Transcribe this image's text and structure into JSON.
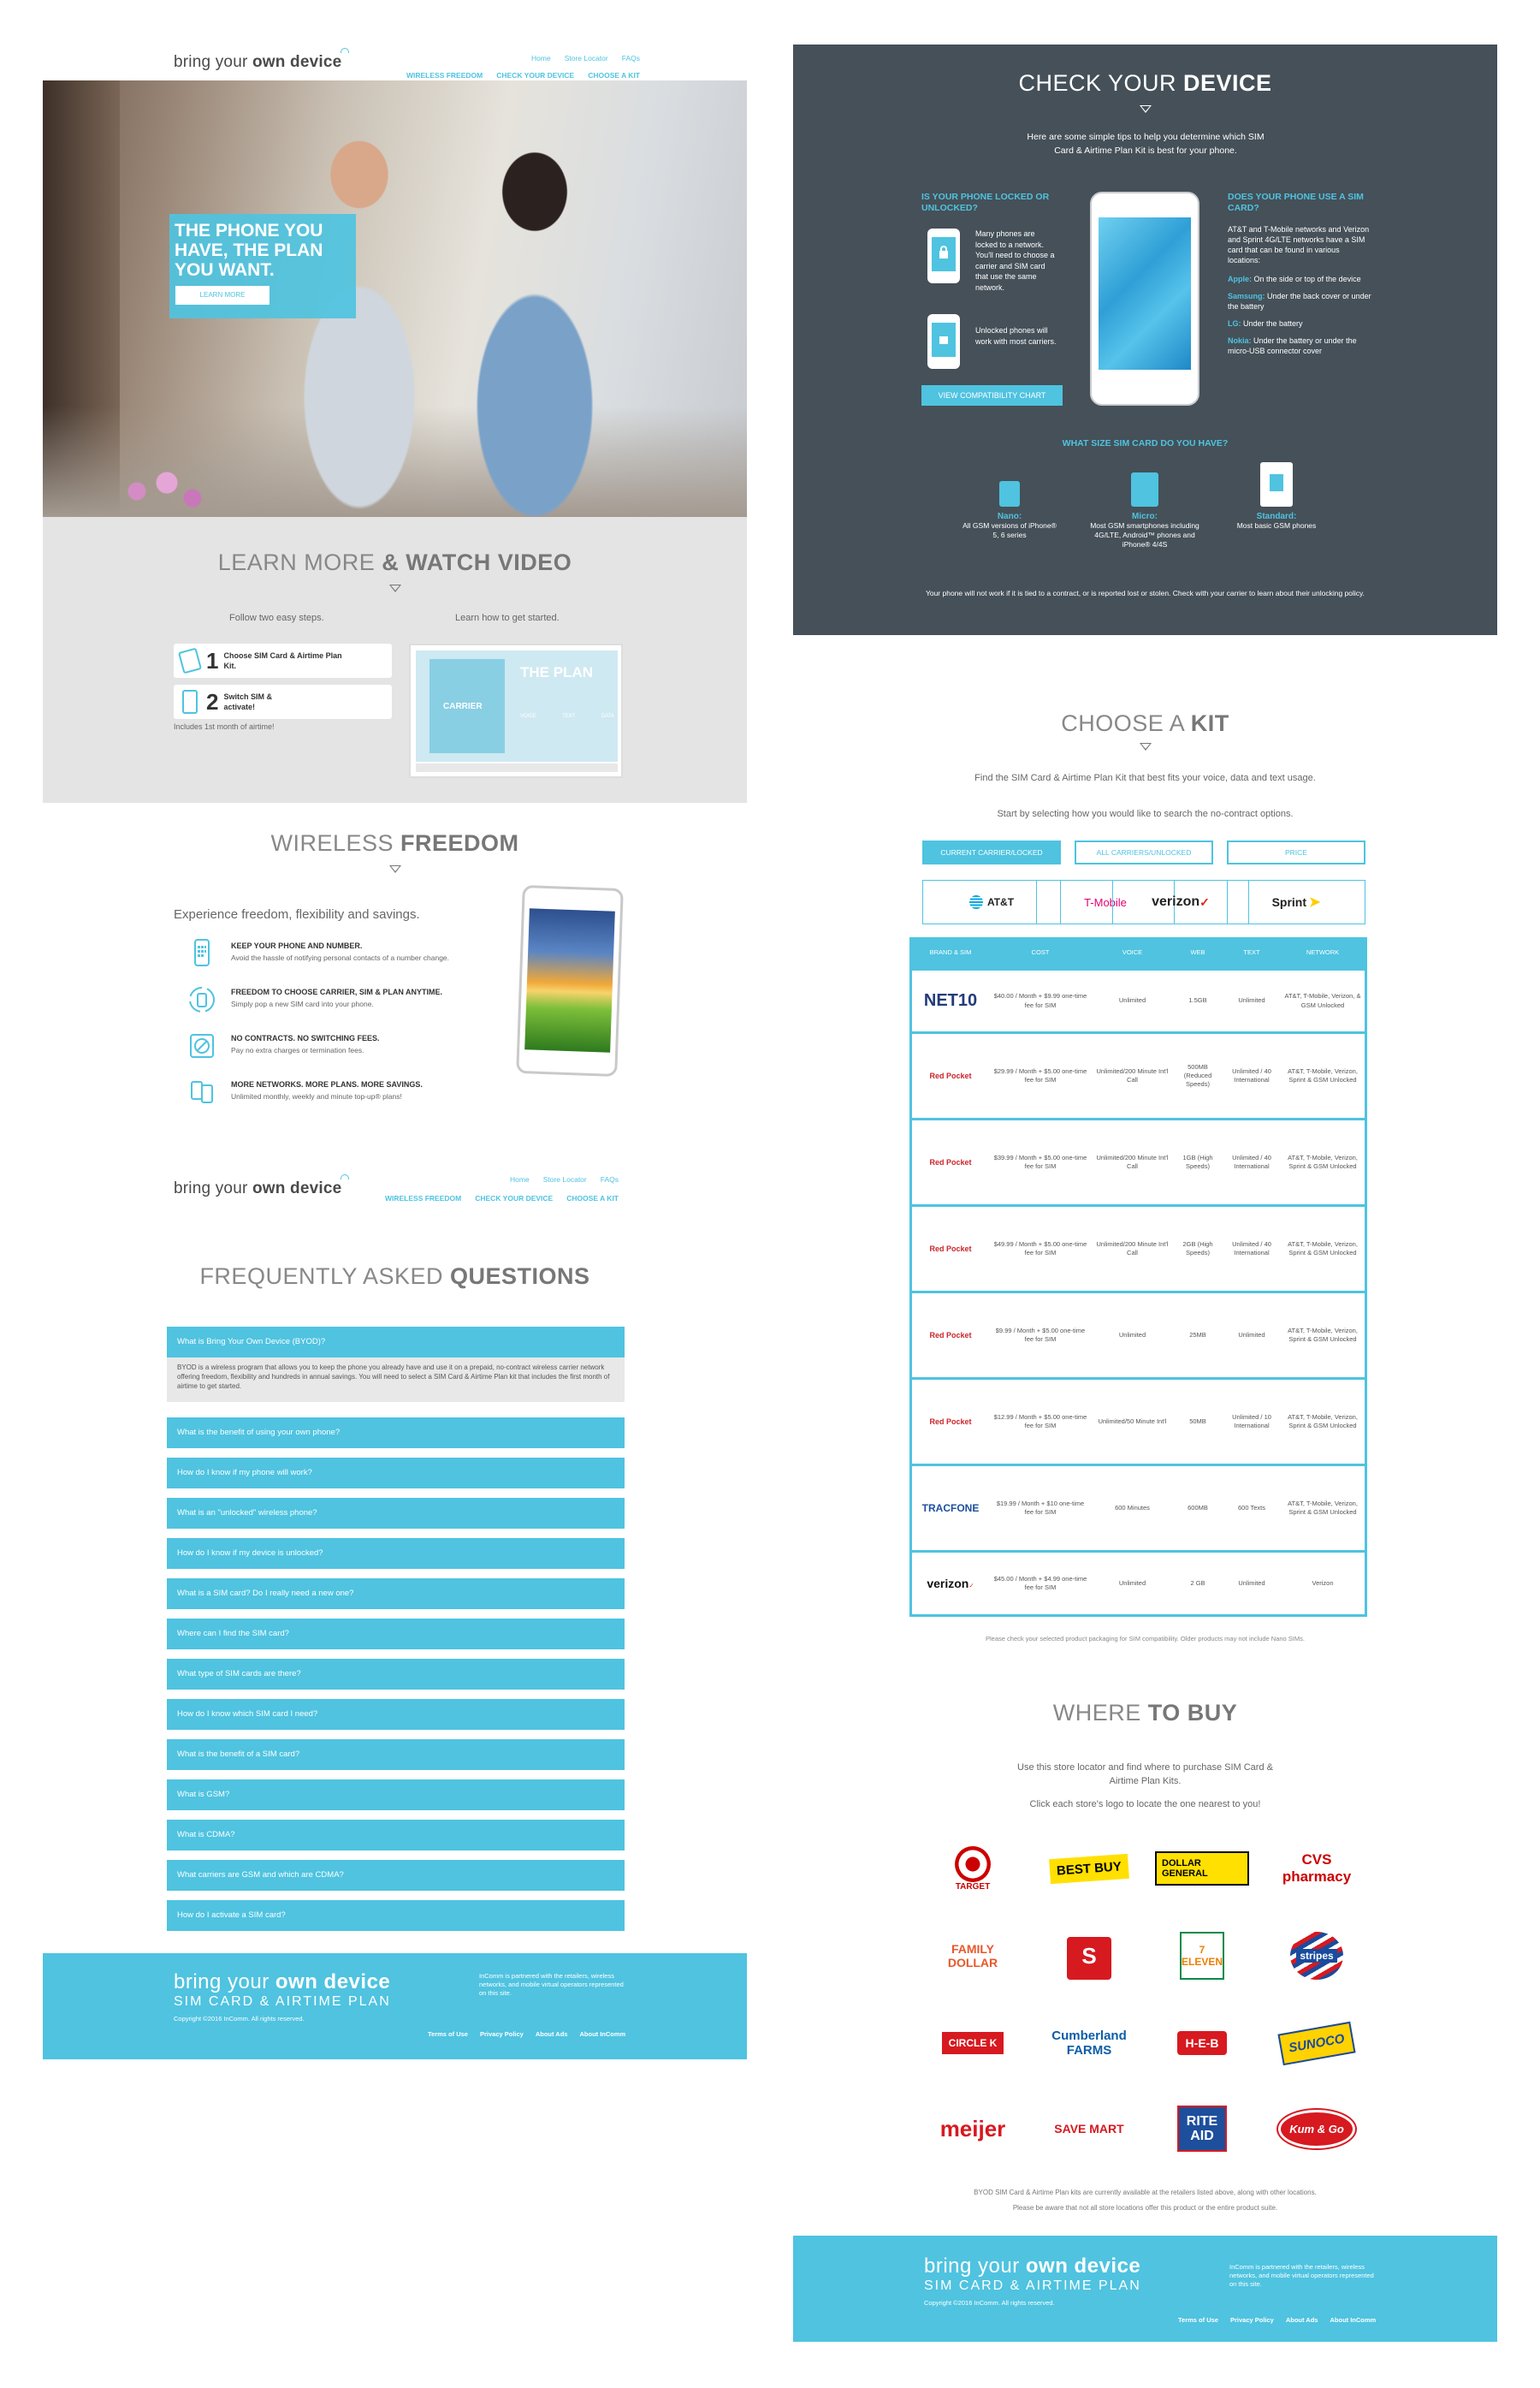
{
  "logo": {
    "prefix": "bring your ",
    "bold": "own device"
  },
  "top_nav": [
    "Home",
    "Store Locator",
    "FAQs"
  ],
  "main_nav": [
    "WIRELESS FREEDOM",
    "CHECK YOUR DEVICE",
    "CHOOSE A KIT"
  ],
  "hero": {
    "headline": "THE PHONE YOU HAVE, THE PLAN YOU WANT.",
    "button": "LEARN MORE"
  },
  "learn": {
    "title_light": "LEARN MORE ",
    "title_bold": "& WATCH VIDEO",
    "left_caption": "Follow two easy steps.",
    "right_caption": "Learn how to get started.",
    "steps": [
      {
        "num": "1",
        "text": "Choose SIM Card & Airtime Plan Kit."
      },
      {
        "num": "2",
        "text": "Switch SIM & activate!"
      }
    ],
    "footnote": "Includes 1st month of airtime!",
    "video": {
      "title": "THE PLAN",
      "subtitle": "CARRIER",
      "labels": [
        "VOICE",
        "TEXT",
        "DATA"
      ]
    }
  },
  "wireless": {
    "title_light": "WIRELESS ",
    "title_bold": "FREEDOM",
    "intro": "Experience freedom, flexibility and savings.",
    "features": [
      {
        "icon": "phone-number-icon",
        "title": "KEEP YOUR PHONE AND NUMBER.",
        "text": "Avoid the hassle of notifying personal contacts of a number change."
      },
      {
        "icon": "switch-carrier-icon",
        "title": "FREEDOM TO CHOOSE CARRIER, SIM & PLAN ANYTIME.",
        "text": "Simply pop a new SIM card into your phone."
      },
      {
        "icon": "no-contract-icon",
        "title": "NO CONTRACTS. NO SWITCHING FEES.",
        "text": "Pay no extra charges or termination fees."
      },
      {
        "icon": "networks-icon",
        "title": "MORE NETWORKS. MORE PLANS. MORE SAVINGS.",
        "text": "Unlimited monthly, weekly and minute top-up® plans!"
      }
    ]
  },
  "faq": {
    "title_light": "FREQUENTLY ASKED ",
    "title_bold": "QUESTIONS",
    "open_question": "What is Bring Your Own Device (BYOD)?",
    "open_answer": "BYOD is a wireless program that allows you to keep the phone you already have and use it on a prepaid, no-contract wireless carrier network offering freedom, flexibility and hundreds in annual savings. You will need to select a SIM Card & Airtime Plan kit that includes the first month of airtime to get started.",
    "questions": [
      "What is the benefit of using your own phone?",
      "How do I know if my phone will work?",
      "What is an \"unlocked\" wireless phone?",
      "How do I know if my device is unlocked?",
      "What is a SIM card? Do I really need a new one?",
      "Where can I find the SIM card?",
      "What type of SIM cards are there?",
      "How do I know which SIM card I need?",
      "What is the benefit of a SIM card?",
      "What is GSM?",
      "What is CDMA?",
      "What carriers are GSM and which are CDMA?",
      "How do I activate a SIM card?"
    ]
  },
  "footer": {
    "logo_prefix": "bring your ",
    "logo_bold": "own device",
    "sub": "SIM CARD & AIRTIME PLAN",
    "copyright": "Copyright ©2016 InComm. All rights reserved.",
    "partner": "InComm is partnered with the retailers, wireless networks, and mobile virtual operators represented on this site.",
    "links": [
      "Terms of Use",
      "Privacy Policy",
      "About Ads",
      "About InComm"
    ]
  },
  "check": {
    "title_light": "CHECK YOUR ",
    "title_bold": "DEVICE",
    "intro": "Here are some simple tips to help you determine which SIM Card & Airtime Plan Kit is best for your phone.",
    "locked_heading": "IS YOUR PHONE LOCKED OR UNLOCKED?",
    "locked_text": "Many phones are locked to a network. You'll need to choose a carrier and SIM card that use the same network.",
    "unlocked_text": "Unlocked phones will work with most carriers.",
    "compat_button": "VIEW COMPATIBILITY CHART",
    "sim_heading": "DOES YOUR PHONE USE A SIM CARD?",
    "sim_text": "AT&T and T-Mobile networks and Verizon and Sprint 4G/LTE networks have a SIM card that can be found in various locations:",
    "locations": [
      {
        "brand": "Apple:",
        "text": "On the side or top of the device"
      },
      {
        "brand": "Samsung:",
        "text": "Under the back cover or under the battery"
      },
      {
        "brand": "LG:",
        "text": "Under the battery"
      },
      {
        "brand": "Nokia:",
        "text": "Under the battery or under the micro-USB connector cover"
      }
    ],
    "size_heading": "WHAT SIZE SIM CARD DO YOU HAVE?",
    "sizes": [
      {
        "name": "Nano:",
        "text": "All GSM versions of iPhone® 5, 6 series"
      },
      {
        "name": "Micro:",
        "text": "Most GSM smartphones including 4G/LTE, Android™ phones and iPhone® 4/4S"
      },
      {
        "name": "Standard:",
        "text": "Most basic GSM phones"
      }
    ],
    "note": "Your phone will not work if it is tied to a contract, or is reported lost or stolen. Check with your carrier to learn about their unlocking policy."
  },
  "kit": {
    "title_light": "CHOOSE A ",
    "title_bold": "KIT",
    "intro": "Find the SIM Card & Airtime Plan Kit that best fits your voice, data and text usage.",
    "instruction": "Start by selecting how you would like to search the no-contract options.",
    "tabs": [
      "CURRENT CARRIER/LOCKED",
      "ALL CARRIERS/UNLOCKED",
      "PRICE"
    ],
    "carriers": [
      "AT&T",
      "T-Mobile",
      "verizon",
      "Sprint"
    ],
    "columns": [
      "BRAND & SIM",
      "COST",
      "VOICE",
      "WEB",
      "TEXT",
      "NETWORK"
    ],
    "rows": [
      {
        "brand": "NET10",
        "cost": "$40.00 / Month + $9.99 one-time fee for SIM",
        "voice": "Unlimited",
        "web": "1.5GB",
        "text": "Unlimited",
        "network": "AT&T, T-Mobile, Verizon, & GSM Unlocked"
      },
      {
        "brand": "Red Pocket",
        "cost": "$29.99 / Month + $5.00 one-time fee for SIM",
        "voice": "Unlimited/200 Minute Int'l Call",
        "web": "500MB (Reduced Speeds)",
        "text": "Unlimited / 40 International",
        "network": "AT&T, T-Mobile, Verizon, Sprint & GSM Unlocked"
      },
      {
        "brand": "Red Pocket",
        "cost": "$39.99 / Month + $5.00 one-time fee for SIM",
        "voice": "Unlimited/200 Minute Int'l Call",
        "web": "1GB (High Speeds)",
        "text": "Unlimited / 40 International",
        "network": "AT&T, T-Mobile, Verizon, Sprint & GSM Unlocked"
      },
      {
        "brand": "Red Pocket",
        "cost": "$49.99 / Month + $5.00 one-time fee for SIM",
        "voice": "Unlimited/200 Minute Int'l Call",
        "web": "2GB (High Speeds)",
        "text": "Unlimited / 40 International",
        "network": "AT&T, T-Mobile, Verizon, Sprint & GSM Unlocked"
      },
      {
        "brand": "Red Pocket",
        "cost": "$9.99 / Month + $5.00 one-time fee for SIM",
        "voice": "Unlimited",
        "web": "25MB",
        "text": "Unlimited",
        "network": "AT&T, T-Mobile, Verizon, Sprint & GSM Unlocked"
      },
      {
        "brand": "Red Pocket",
        "cost": "$12.99 / Month + $5.00 one-time fee for SIM",
        "voice": "Unlimited/50 Minute Int'l",
        "web": "50MB",
        "text": "Unlimited / 10 International",
        "network": "AT&T, T-Mobile, Verizon, Sprint & GSM Unlocked"
      },
      {
        "brand": "TRACFONE",
        "cost": "$19.99 / Month + $10 one-time fee for SIM",
        "voice": "600 Minutes",
        "web": "600MB",
        "text": "600 Texts",
        "network": "AT&T, T-Mobile, Verizon, Sprint & GSM Unlocked"
      },
      {
        "brand": "verizon",
        "cost": "$45.00 / Month + $4.99 one-time fee for SIM",
        "voice": "Unlimited",
        "web": "2 GB",
        "text": "Unlimited",
        "network": "Verizon"
      }
    ],
    "table_note": "Please check your selected product packaging for SIM compatibility. Older products may not include Nano SIMs."
  },
  "buy": {
    "title_light": "WHERE ",
    "title_bold": "TO BUY",
    "intro": "Use this store locator and find where to purchase SIM Card & Airtime Plan Kits.",
    "instruction": "Click each store's logo to locate the one nearest to you!",
    "stores": [
      "TARGET",
      "BEST BUY",
      "DOLLAR GENERAL",
      "CVS pharmacy",
      "FAMILY DOLLAR",
      "Speedway",
      "7 ELEVEN",
      "stripes",
      "CIRCLE K",
      "Cumberland FARMS",
      "H-E-B",
      "SUNOCO",
      "meijer",
      "SAVE MART",
      "RITE AID",
      "Kum & Go"
    ],
    "note1": "BYOD SIM Card & Airtime Plan kits are currently available at the retailers listed above, along with other locations.",
    "note2": "Please be aware that not all store locations offer this product or the entire product suite."
  },
  "colors": {
    "accent": "#4fc3e0",
    "dark_panel": "#455058",
    "grey_panel": "#e4e4e4"
  }
}
